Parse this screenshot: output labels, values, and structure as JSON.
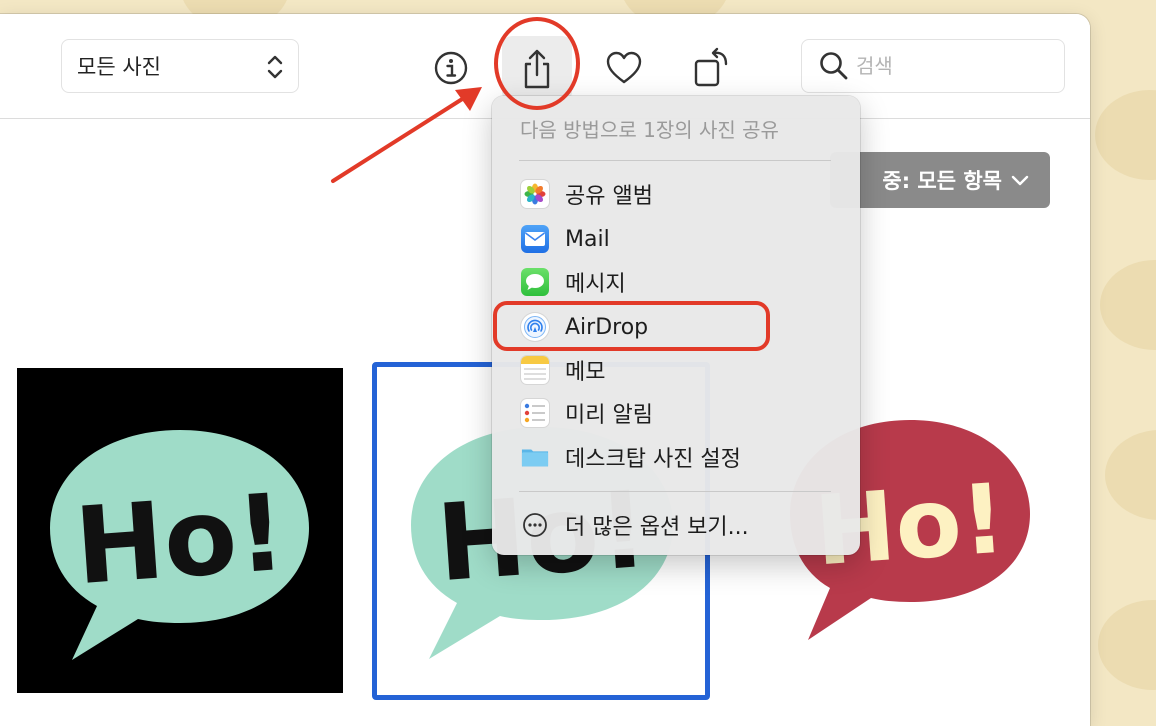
{
  "toolbar": {
    "view_select_value": "모든 사진",
    "search_placeholder": "검색"
  },
  "filter": {
    "label": "중: 모든 항목"
  },
  "photos": [
    {
      "text": "Ho!",
      "bubble_color": "#9fdcc8",
      "background": "#000000",
      "text_color": "#111111"
    },
    {
      "text": "Ho!",
      "bubble_color": "#9fdcc8",
      "background": "#ffffff",
      "text_color": "#111111",
      "selected": true
    },
    {
      "text": "Ho!",
      "bubble_color": "#b83a4b",
      "background": "#ffffff",
      "text_color": "#fdf1c2"
    }
  ],
  "share_menu": {
    "title": "다음 방법으로 1장의 사진 공유",
    "items": [
      {
        "label": "공유 앨범",
        "icon": "photos-icon"
      },
      {
        "label": "Mail",
        "icon": "mail-icon"
      },
      {
        "label": "메시지",
        "icon": "messages-icon"
      },
      {
        "label": "AirDrop",
        "icon": "airdrop-icon"
      },
      {
        "label": "메모",
        "icon": "notes-icon"
      },
      {
        "label": "미리 알림",
        "icon": "reminders-icon"
      },
      {
        "label": "데스크탑 사진 설정",
        "icon": "desktop-folder-icon"
      }
    ],
    "more_label": "더 많은 옵션 보기..."
  },
  "colors": {
    "accent_selection": "#2463d6",
    "annotation": "#e23a28"
  }
}
